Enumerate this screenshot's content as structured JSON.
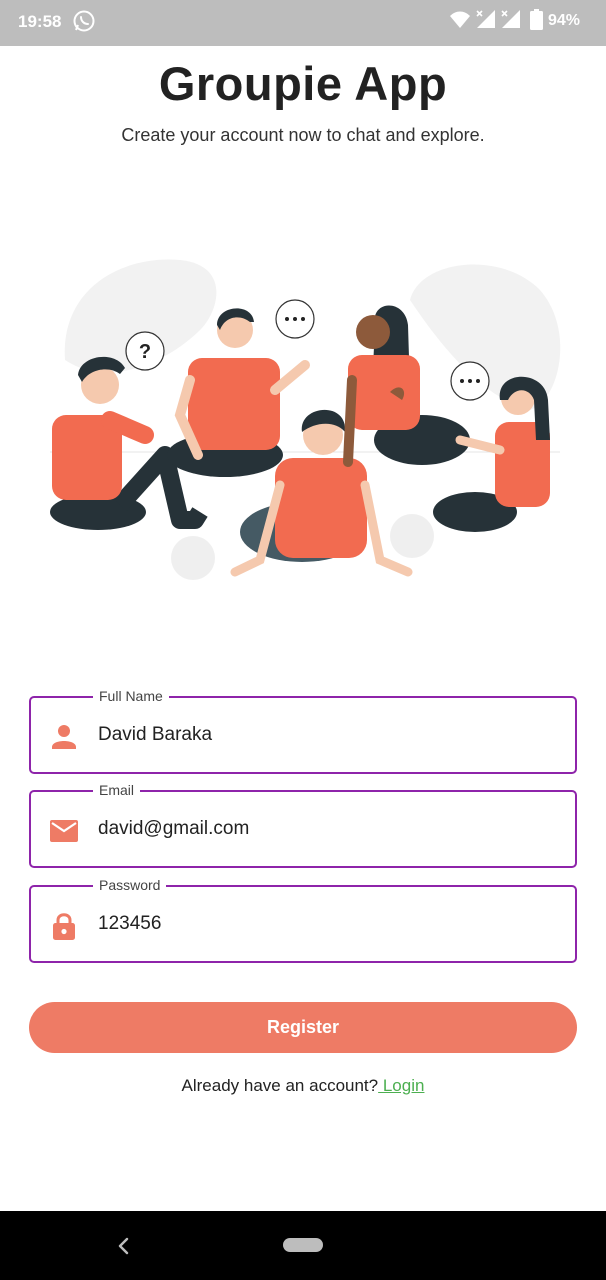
{
  "status_bar": {
    "time": "19:58",
    "battery": "94%",
    "icons": [
      "whatsapp-icon",
      "wifi-icon",
      "signal-icon",
      "signal-icon",
      "battery-icon"
    ]
  },
  "header": {
    "title": "Groupie App",
    "subtitle": "Create your account now to chat and explore."
  },
  "illustration": {
    "name": "group-chat-illustration",
    "accent_color": "#f26b50"
  },
  "form": {
    "full_name": {
      "label": "Full Name",
      "value": "David Baraka",
      "icon": "person-icon"
    },
    "email": {
      "label": "Email",
      "value": "david@gmail.com",
      "icon": "mail-icon"
    },
    "password": {
      "label": "Password",
      "value": "123456",
      "icon": "lock-icon"
    },
    "border_color": "#8e24aa",
    "icon_color": "#ee7b65"
  },
  "register": {
    "label": "Register",
    "color": "#ee7b65"
  },
  "login": {
    "prompt": "Already have an account?",
    "link": " Login",
    "link_color": "#4caf50"
  },
  "nav_bar": {
    "icons": [
      "back-icon",
      "home-pill"
    ]
  }
}
